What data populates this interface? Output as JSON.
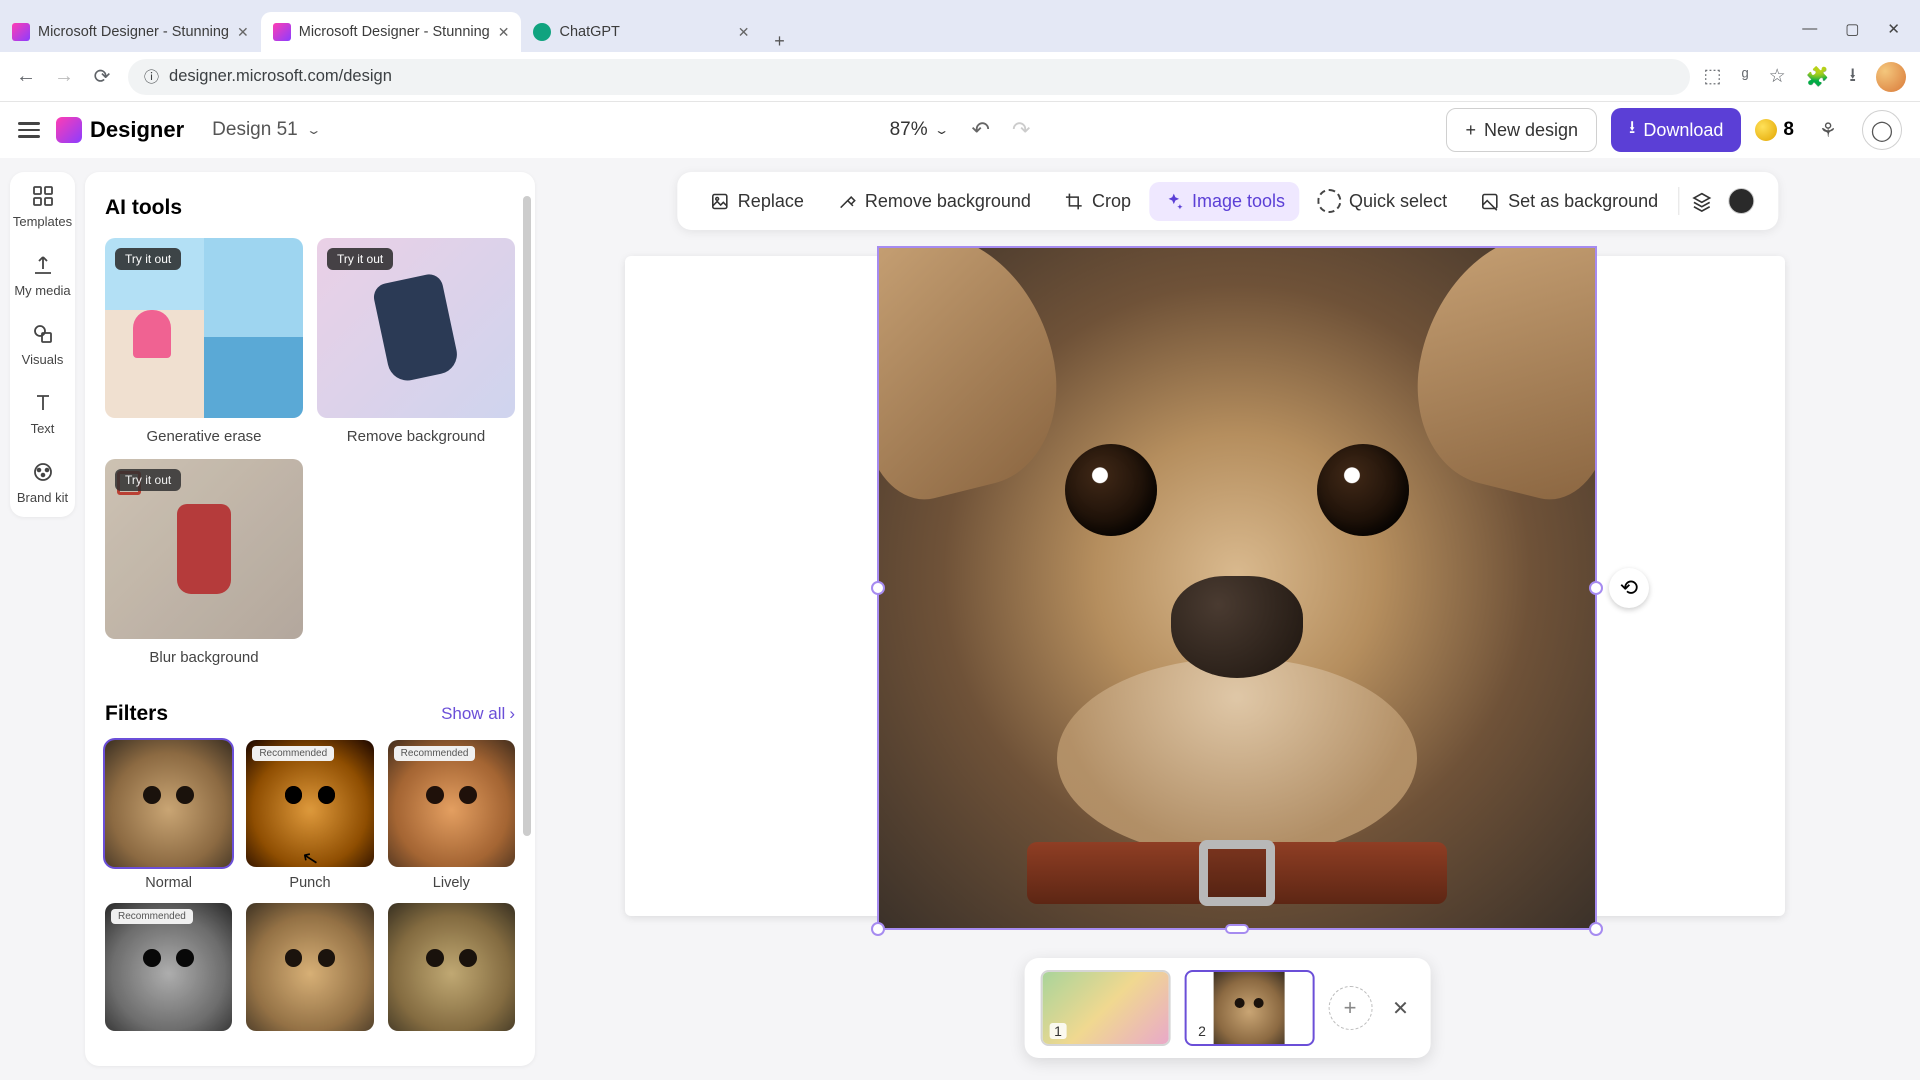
{
  "browser": {
    "tabs": [
      {
        "title": "Microsoft Designer - Stunning",
        "favicon": "designer",
        "active": false
      },
      {
        "title": "Microsoft Designer - Stunning",
        "favicon": "designer",
        "active": true
      },
      {
        "title": "ChatGPT",
        "favicon": "chatgpt",
        "active": false
      }
    ],
    "url": "designer.microsoft.com/design"
  },
  "header": {
    "logo_text": "Designer",
    "design_name": "Design 51",
    "zoom": "87%",
    "new_design_label": "New design",
    "download_label": "Download",
    "credits": "8"
  },
  "rail": {
    "items": [
      {
        "label": "Templates",
        "icon": "templates"
      },
      {
        "label": "My media",
        "icon": "upload"
      },
      {
        "label": "Visuals",
        "icon": "visuals"
      },
      {
        "label": "Text",
        "icon": "text"
      },
      {
        "label": "Brand kit",
        "icon": "brandkit"
      }
    ]
  },
  "panel": {
    "ai_tools_heading": "AI tools",
    "try_badge": "Try it out",
    "tools": [
      {
        "label": "Generative erase"
      },
      {
        "label": "Remove background"
      },
      {
        "label": "Blur background"
      }
    ],
    "filters_heading": "Filters",
    "show_all": "Show all",
    "recommended_badge": "Recommended",
    "filters": [
      {
        "label": "Normal",
        "variant": "normal",
        "selected": true,
        "recommended": false
      },
      {
        "label": "Punch",
        "variant": "punch",
        "selected": false,
        "recommended": true
      },
      {
        "label": "Lively",
        "variant": "lively",
        "selected": false,
        "recommended": true
      },
      {
        "label": "",
        "variant": "gray",
        "selected": false,
        "recommended": true
      },
      {
        "label": "",
        "variant": "warm",
        "selected": false,
        "recommended": false
      },
      {
        "label": "",
        "variant": "cool",
        "selected": false,
        "recommended": false
      }
    ]
  },
  "context_bar": {
    "replace": "Replace",
    "remove_bg": "Remove background",
    "crop": "Crop",
    "image_tools": "Image tools",
    "quick_select": "Quick select",
    "set_bg": "Set as background"
  },
  "pages": {
    "items": [
      {
        "num": "1",
        "active": false
      },
      {
        "num": "2",
        "active": true
      }
    ]
  }
}
